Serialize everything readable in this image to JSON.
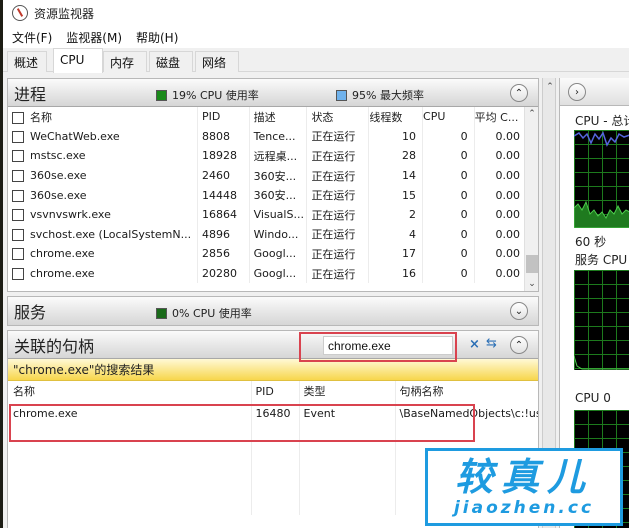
{
  "window": {
    "title": "资源监视器"
  },
  "menu": [
    "文件(F)",
    "监视器(M)",
    "帮助(H)"
  ],
  "tabs": [
    "概述",
    "CPU",
    "内存",
    "磁盘",
    "网络"
  ],
  "active_tab": "CPU",
  "colors": {
    "cpu_usage": "#1a8a1a",
    "max_freq": "#6fb2ec",
    "services_cpu": "#1a6a1a",
    "highlight_box": "#d9434f",
    "results_bar": "#f7d64c",
    "watermark": "#1e9be0"
  },
  "processes": {
    "title": "进程",
    "cpu_usage_label": "19% CPU 使用率",
    "max_freq_label": "95% 最大频率",
    "collapse_icon": "chevron-up-icon",
    "columns": [
      "名称",
      "PID",
      "描述",
      "状态",
      "线程数",
      "CPU",
      "平均 C..."
    ],
    "rows": [
      {
        "name": "WeChatWeb.exe",
        "pid": "8808",
        "desc": "Tence...",
        "status": "正在运行",
        "threads": "10",
        "cpu": "0",
        "avg": "0.00"
      },
      {
        "name": "mstsc.exe",
        "pid": "18928",
        "desc": "远程桌...",
        "status": "正在运行",
        "threads": "28",
        "cpu": "0",
        "avg": "0.00"
      },
      {
        "name": "360se.exe",
        "pid": "2460",
        "desc": "360安...",
        "status": "正在运行",
        "threads": "14",
        "cpu": "0",
        "avg": "0.00"
      },
      {
        "name": "360se.exe",
        "pid": "14448",
        "desc": "360安...",
        "status": "正在运行",
        "threads": "15",
        "cpu": "0",
        "avg": "0.00"
      },
      {
        "name": "vsvnvswrk.exe",
        "pid": "16864",
        "desc": "VisualS...",
        "status": "正在运行",
        "threads": "2",
        "cpu": "0",
        "avg": "0.00"
      },
      {
        "name": "svchost.exe (LocalSystemN...",
        "pid": "4896",
        "desc": "Windo...",
        "status": "正在运行",
        "threads": "4",
        "cpu": "0",
        "avg": "0.00"
      },
      {
        "name": "chrome.exe",
        "pid": "2856",
        "desc": "Googl...",
        "status": "正在运行",
        "threads": "17",
        "cpu": "0",
        "avg": "0.00"
      },
      {
        "name": "chrome.exe",
        "pid": "20280",
        "desc": "Googl...",
        "status": "正在运行",
        "threads": "16",
        "cpu": "0",
        "avg": "0.00"
      }
    ]
  },
  "services": {
    "title": "服务",
    "cpu_usage_label": "0% CPU 使用率",
    "expand_icon": "chevron-down-icon"
  },
  "handles": {
    "title": "关联的句柄",
    "search_value": "chrome.exe",
    "clear_icon": "clear-x-icon",
    "refresh_icon": "refresh-icon",
    "results_label": "\"chrome.exe\"的搜索结果",
    "columns": [
      "名称",
      "PID",
      "类型",
      "句柄名称"
    ],
    "rows": [
      {
        "name": "chrome.exe",
        "pid": "16480",
        "type": "Event",
        "handle": "\\BaseNamedObjects\\c:!us"
      }
    ]
  },
  "graphs": {
    "expand_icon": "chevron-right-icon",
    "cpu_total_label": "CPU - 总计",
    "time_label": "60 秒",
    "service_cpu_label": "服务 CPU",
    "cpu0_label": "CPU 0"
  },
  "watermark": {
    "big": "较真儿",
    "small": "jiaozhen.cc"
  }
}
